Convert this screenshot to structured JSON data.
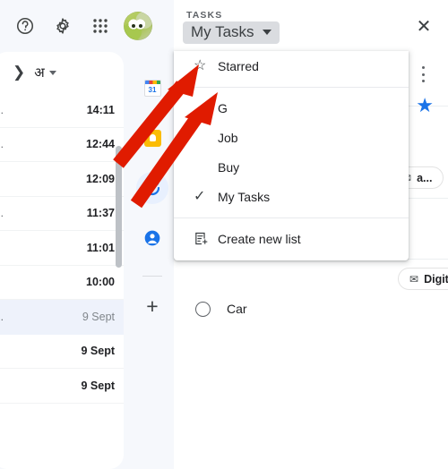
{
  "app": {
    "topbar": {
      "help_icon": "help-icon",
      "settings_icon": "gear-icon",
      "apps_icon": "apps-grid-icon",
      "avatar_label": "Account"
    },
    "mail": {
      "collapse_icon": "chevron-right-icon",
      "language_label": "अ",
      "rows": [
        {
          "snippet": "...",
          "time": "14:11",
          "selected": false
        },
        {
          "snippet": "...",
          "time": "12:44",
          "selected": false
        },
        {
          "snippet": "..",
          "time": "12:09",
          "selected": false
        },
        {
          "snippet": "...",
          "time": "11:37",
          "selected": false
        },
        {
          "snippet": "..",
          "time": "11:01",
          "selected": false
        },
        {
          "snippet": ".",
          "time": "10:00",
          "selected": false
        },
        {
          "snippet": "...",
          "time": "9 Sept",
          "selected": true
        },
        {
          "snippet": "..",
          "time": "9 Sept",
          "selected": false
        },
        {
          "snippet": ".",
          "time": "9 Sept",
          "selected": false
        }
      ]
    },
    "rail": {
      "items": [
        {
          "name": "calendar-icon",
          "label": "Calendar",
          "badge": "31",
          "active": false
        },
        {
          "name": "keep-icon",
          "label": "Keep",
          "active": false
        },
        {
          "name": "tasks-icon",
          "label": "Tasks",
          "active": true
        },
        {
          "name": "contacts-icon",
          "label": "Contacts",
          "active": false
        }
      ],
      "add_label": "+"
    }
  },
  "tasks": {
    "header_label": "TASKS",
    "selected_list": "My Tasks",
    "caret_icon": "chevron-down-icon",
    "close_label": "✕",
    "more_icon": "more-vert-icon",
    "star_icon": "star-filled-icon",
    "hidden_chip": {
      "icon": "mail-icon",
      "text": "a..."
    },
    "visible_chip": {
      "icon": "mail-icon",
      "text": "Digital Survey for National Curricu..."
    },
    "task": {
      "title": "Car",
      "checkbox_icon": "circle-unchecked-icon"
    }
  },
  "menu": {
    "items": [
      {
        "label": "Starred",
        "icon": "star-outline-icon",
        "checked": false
      },
      {
        "label": "G",
        "icon": null,
        "checked": false
      },
      {
        "label": "Job",
        "icon": null,
        "checked": false
      },
      {
        "label": "Buy",
        "icon": null,
        "checked": false
      },
      {
        "label": "My Tasks",
        "icon": "check-icon",
        "checked": true
      }
    ],
    "create": {
      "label": "Create new list",
      "icon": "new-list-icon"
    }
  },
  "annotations": {
    "arrow_color": "#e01b00",
    "arrows": [
      {
        "name": "arrow-to-starred"
      },
      {
        "name": "arrow-to-menu"
      }
    ]
  },
  "colors": {
    "accent": "#1a73e8",
    "panel_bg": "#f6f8fc",
    "selected_row": "#eef2fb",
    "chip_border": "#e3e3e3"
  }
}
